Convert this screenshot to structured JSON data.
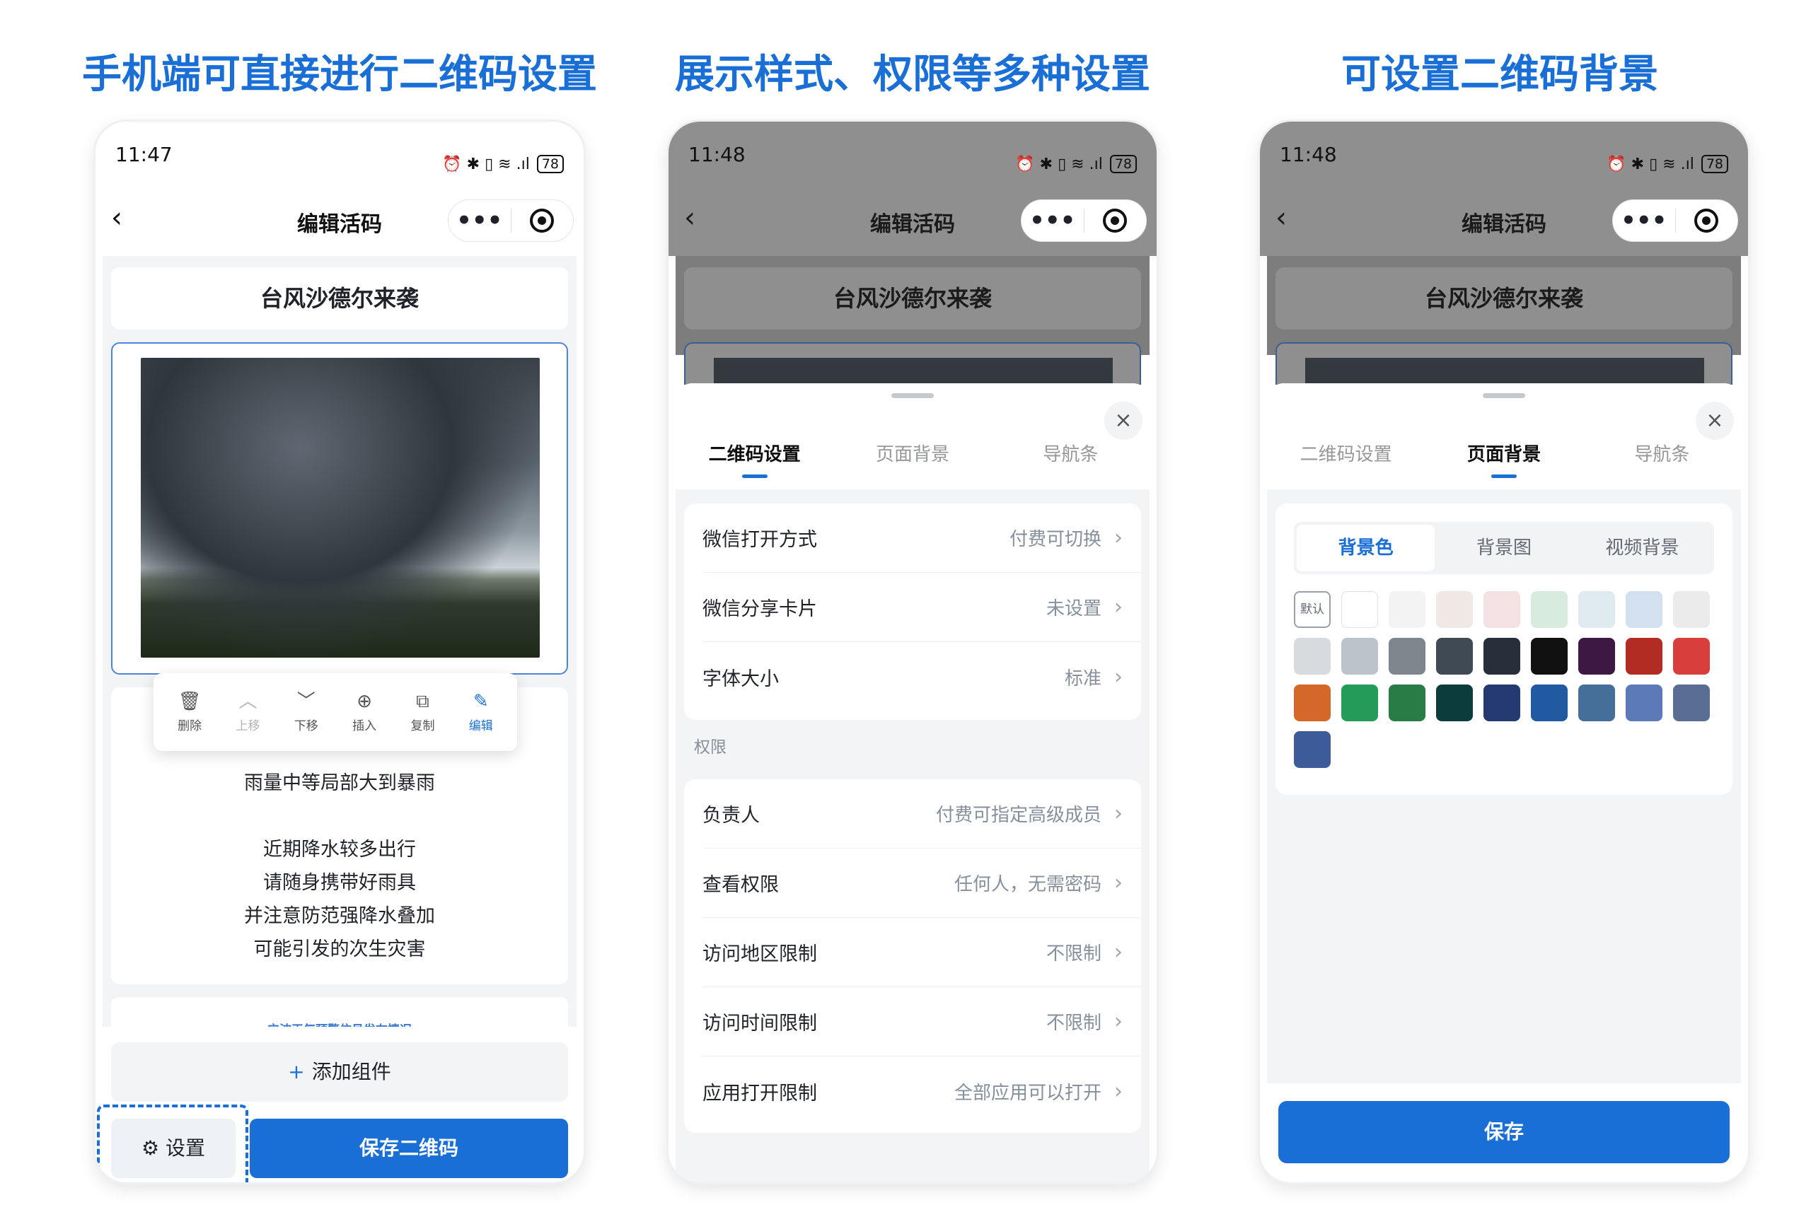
{
  "headlines": {
    "left": "手机端可直接进行二维码设置",
    "center": "展示样式、权限等多种设置",
    "right": "可设置二维码背景"
  },
  "status": {
    "time_left": "11:47",
    "time_center": "11:48",
    "time_right": "11:48",
    "icons": "⏰ ✱ ▯ ≋ .ıl",
    "battery": "78"
  },
  "nav": {
    "back_icon": "‹",
    "title": "编辑活码",
    "more_icon": "•••"
  },
  "editor": {
    "page_title": "台风沙德尔来袭",
    "text_lines": [
      "雨量中等局部大到暴雨",
      "",
      "近期降水较多出行",
      "请随身携带好雨具",
      "并注意防范强降水叠加",
      "可能引发的次生灾害"
    ],
    "toolbar": [
      {
        "icon": "🗑",
        "label": "删除"
      },
      {
        "icon": "︿",
        "label": "上移"
      },
      {
        "icon": "﹀",
        "label": "下移"
      },
      {
        "icon": "⊕",
        "label": "插入"
      },
      {
        "icon": "⧉",
        "label": "复制"
      },
      {
        "icon": "✎",
        "label": "编辑"
      }
    ],
    "mini_card_title": "宁波天气预警信号发布情况",
    "add_component": "添加组件",
    "add_plus": "+",
    "settings": "设置",
    "settings_icon": "⚙",
    "save_qr": "保存二维码"
  },
  "sheet": {
    "close_icon": "×",
    "tabs": [
      "二维码设置",
      "页面背景",
      "导航条"
    ],
    "group1": [
      {
        "label": "微信打开方式",
        "value": "付费可切换"
      },
      {
        "label": "微信分享卡片",
        "value": "未设置"
      },
      {
        "label": "字体大小",
        "value": "标准"
      }
    ],
    "section_label": "权限",
    "group2": [
      {
        "label": "负责人",
        "value": "付费可指定高级成员"
      },
      {
        "label": "查看权限",
        "value": "任何人，无需密码"
      },
      {
        "label": "访问地区限制",
        "value": "不限制"
      },
      {
        "label": "访问时间限制",
        "value": "不限制"
      },
      {
        "label": "应用打开限制",
        "value": "全部应用可以打开"
      }
    ],
    "chevron": "›"
  },
  "background": {
    "segments": [
      "背景色",
      "背景图",
      "视频背景"
    ],
    "default_label": "默认",
    "colors": [
      "#ffffff",
      "#f3f3f3",
      "#efe8e4",
      "#f3e1e3",
      "#d7ebdf",
      "#dfe9f0",
      "#d3e0ef",
      "#ebebeb",
      "#d8dbde",
      "#bcc3ca",
      "#7d858d",
      "#3f4a55",
      "#262f3a",
      "#111111",
      "#3d1843",
      "#b12d24",
      "#d83e3b",
      "#d46828",
      "#249b58",
      "#2a7c46",
      "#0d3c3c",
      "#243a70",
      "#215aa0",
      "#456f98",
      "#5d7ab8",
      "#5a6d95",
      "#3d5b98"
    ],
    "save": "保存"
  }
}
